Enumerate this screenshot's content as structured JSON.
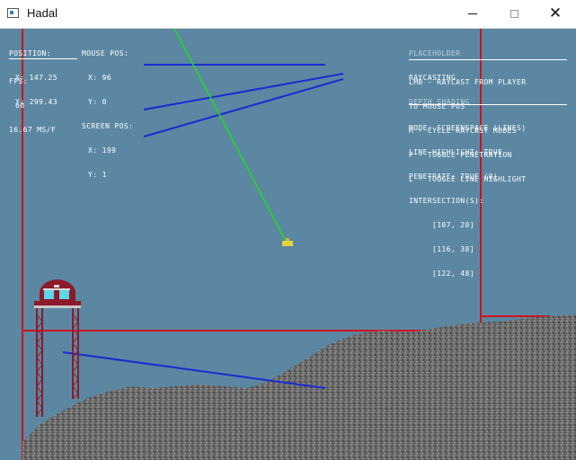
{
  "window": {
    "title": "Hadal",
    "icon": "app-icon",
    "buttons": {
      "minimize": "minimize-icon",
      "maximize": "maximize-icon",
      "close": "close-icon"
    }
  },
  "hud": {
    "position_label": "POSITION:",
    "position_x": "X: 147.25",
    "position_y": "Y: 299.43",
    "fps_label": "FPS:",
    "fps_value": "60",
    "frame_time": "16.67 MS/F",
    "mouse_label": "MOUSE POS:",
    "mouse_x": "X: 96",
    "mouse_y": "Y: 0",
    "screen_label": "SCREEN POS:",
    "screen_x": "X: 199",
    "screen_y": "Y: 1"
  },
  "info_panel": {
    "modes": [
      "PLACEHOLDER",
      "RAYCASTING",
      "DEPTH SHADING"
    ],
    "controls": [
      "LMB - RAYCAST FROM PLAYER",
      "TO MOUSE POS",
      "M - CYCLE RAYCAST MODES",
      "P - TOGGLE PENETRATION",
      "L - TOGGLE LINE HIGHLIGHT"
    ],
    "status": [
      "MODE: SCREENSPACE (LINES)",
      "LINE HIGHLIGHT: TRUE",
      "PENETRATE: TRUE (0)",
      "INTERSECTION(S):"
    ],
    "intersections": [
      "[107, 20]",
      "[116, 38]",
      "[122, 48]"
    ]
  },
  "colors": {
    "background": "#5b87a2",
    "terrain": "#6e6e6e",
    "red_lines": "#d0121b",
    "blue_lines": "#1a2bd0",
    "ray": "#1ee01e",
    "tower": "#8b1a2a",
    "tower_windows": "#5fd6e8"
  }
}
